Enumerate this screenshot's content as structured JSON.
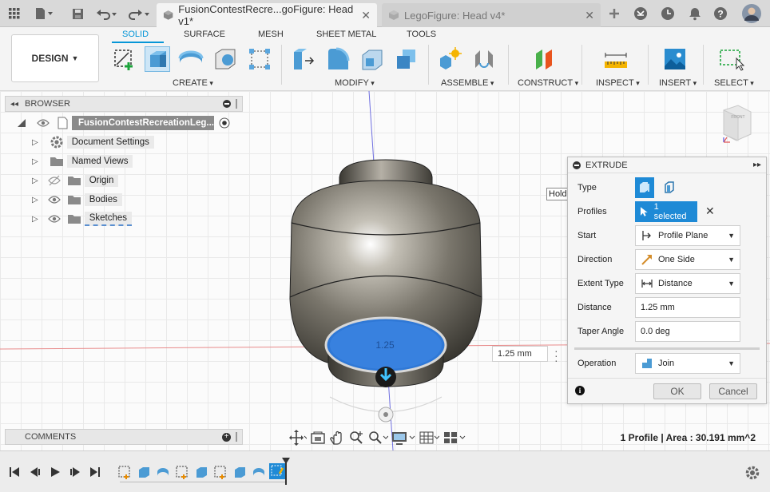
{
  "titlebar": {
    "tabs": [
      {
        "label": "FusionContestRecre...goFigure: Head v1*",
        "active": true
      },
      {
        "label": "LegoFigure: Head v4*",
        "active": false
      }
    ],
    "icons": [
      "apps-grid-icon",
      "file-icon",
      "save-icon",
      "undo-icon",
      "redo-icon",
      "plus-icon",
      "online-icon",
      "clock-icon",
      "notification-icon",
      "help-icon",
      "user-avatar-icon"
    ]
  },
  "toolbar": {
    "workspace": "DESIGN",
    "tabs": [
      "SOLID",
      "SURFACE",
      "MESH",
      "SHEET METAL",
      "TOOLS"
    ],
    "active_tab": "SOLID",
    "groups": [
      "CREATE",
      "MODIFY",
      "ASSEMBLE",
      "CONSTRUCT",
      "INSPECT",
      "INSERT",
      "SELECT"
    ],
    "accent": "#0696d7"
  },
  "browser": {
    "title": "BROWSER",
    "root": "FusionContestRecreationLeg...",
    "items": [
      {
        "label": "Document Settings",
        "icon": "gear-icon"
      },
      {
        "label": "Named Views",
        "icon": "folder-icon"
      },
      {
        "label": "Origin",
        "icon": "folder-icon"
      },
      {
        "label": "Bodies",
        "icon": "folder-icon"
      },
      {
        "label": "Sketches",
        "icon": "folder-icon"
      }
    ]
  },
  "canvas": {
    "tooltip": "Hold Ctrl to mo",
    "distance_input": "1.25 mm",
    "dimension_label": "1.25",
    "viewcube_label": "FRONT"
  },
  "extrude": {
    "title": "EXTRUDE",
    "type_label": "Type",
    "profiles_label": "Profiles",
    "profiles_value": "1 selected",
    "start_label": "Start",
    "start_value": "Profile Plane",
    "direction_label": "Direction",
    "direction_value": "One Side",
    "extent_label": "Extent Type",
    "extent_value": "Distance",
    "distance_label": "Distance",
    "distance_value": "1.25 mm",
    "taper_label": "Taper Angle",
    "taper_value": "0.0 deg",
    "operation_label": "Operation",
    "operation_value": "Join",
    "ok_label": "OK",
    "cancel_label": "Cancel"
  },
  "comments": {
    "title": "COMMENTS"
  },
  "status": {
    "text": "1 Profile | Area : 30.191 mm^2"
  }
}
